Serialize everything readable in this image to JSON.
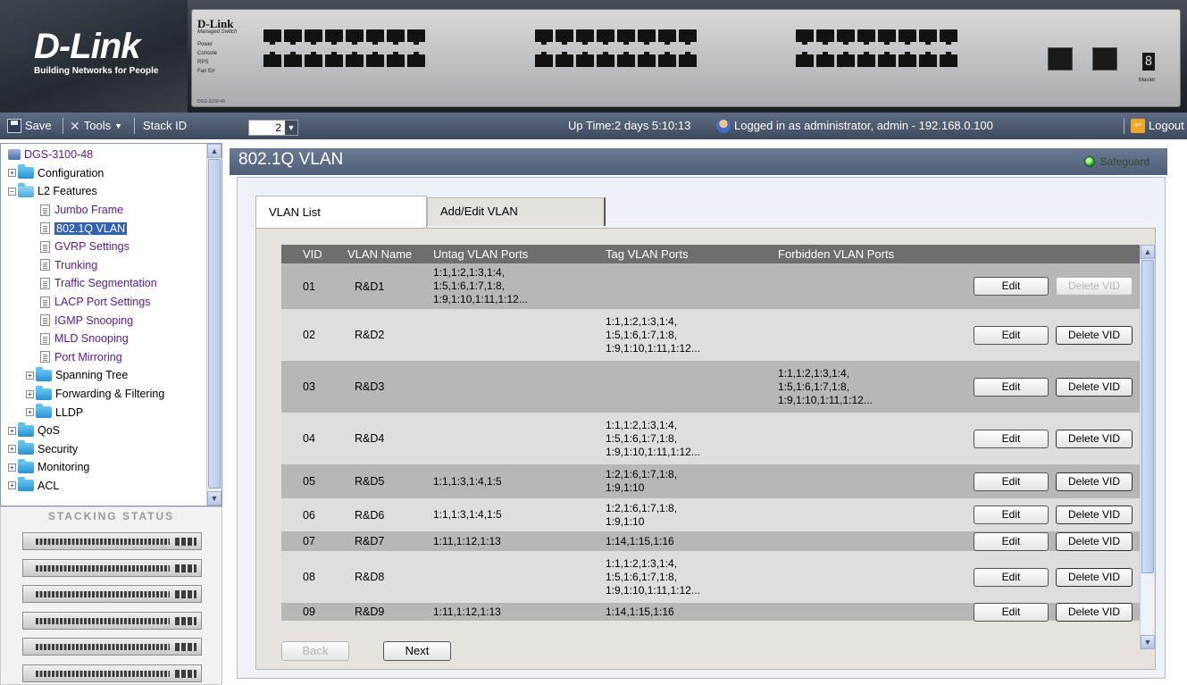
{
  "banner": {
    "logo": "D-Link",
    "tagline": "Building Networks for People",
    "device_brand": "D-Link",
    "device_sub": "Managed Switch",
    "leds": [
      "Power",
      "Console",
      "RPS",
      "Fan Err"
    ],
    "model": "DGS-3100-48",
    "combo_label": "Combo",
    "stack_digit": "8",
    "master_label": "Master"
  },
  "toolbar": {
    "save_label": "Save",
    "tools_label": "Tools",
    "stack_id_label": "Stack ID",
    "stack_id_value": "2",
    "uptime": "Up Time:2 days 5:10:13",
    "logged_in": "Logged in as administrator, admin - 192.168.0.100",
    "logout_label": "Logout"
  },
  "tree": {
    "root": "DGS-3100-48",
    "items": [
      {
        "label": "Configuration",
        "type": "folder",
        "level": 1,
        "expander": "+"
      },
      {
        "label": "L2 Features",
        "type": "folder-open",
        "level": 1,
        "expander": "−"
      },
      {
        "label": "Jumbo Frame",
        "type": "leaf",
        "level": 2
      },
      {
        "label": "802.1Q VLAN",
        "type": "leaf",
        "level": 2,
        "selected": true
      },
      {
        "label": "GVRP Settings",
        "type": "leaf",
        "level": 2
      },
      {
        "label": "Trunking",
        "type": "leaf",
        "level": 2
      },
      {
        "label": "Traffic Segmentation",
        "type": "leaf",
        "level": 2
      },
      {
        "label": "LACP Port Settings",
        "type": "leaf",
        "level": 2
      },
      {
        "label": "IGMP Snooping",
        "type": "leaf",
        "level": 2
      },
      {
        "label": "MLD Snooping",
        "type": "leaf",
        "level": 2
      },
      {
        "label": "Port Mirroring",
        "type": "leaf",
        "level": 2
      },
      {
        "label": "Spanning Tree",
        "type": "folder",
        "level": 2,
        "expander": "+"
      },
      {
        "label": "Forwarding & Filtering",
        "type": "folder",
        "level": 2,
        "expander": "+"
      },
      {
        "label": "LLDP",
        "type": "folder",
        "level": 2,
        "expander": "+"
      },
      {
        "label": "QoS",
        "type": "folder",
        "level": 1,
        "expander": "+"
      },
      {
        "label": "Security",
        "type": "folder",
        "level": 1,
        "expander": "+"
      },
      {
        "label": "Monitoring",
        "type": "folder",
        "level": 1,
        "expander": "+"
      },
      {
        "label": "ACL",
        "type": "folder",
        "level": 1,
        "expander": "+"
      }
    ]
  },
  "stacking": {
    "title": "STACKING STATUS",
    "unit_count": 6
  },
  "main": {
    "title": "802.1Q VLAN",
    "safeguard": "Safeguard",
    "tabs": [
      "VLAN List",
      "Add/Edit VLAN"
    ],
    "columns": [
      "VID",
      "VLAN Name",
      "Untag VLAN Ports",
      "Tag VLAN Ports",
      "Forbidden VLAN Ports"
    ],
    "rows": [
      {
        "vid": "01",
        "name": "R&D1",
        "untag": [
          "1:1,1:2,1:3,1:4,",
          "1:5,1:6,1:7,1:8,",
          "1:9,1:10,1:11,1:12..."
        ],
        "tag": [],
        "forbidden": [],
        "shade": "dark",
        "del_disabled": true
      },
      {
        "vid": "02",
        "name": "R&D2",
        "untag": [],
        "tag": [
          "1:1,1:2,1:3,1:4,",
          "1:5,1:6,1:7,1:8,",
          "1:9,1:10,1:11,1:12..."
        ],
        "forbidden": [],
        "shade": "light",
        "del_disabled": false
      },
      {
        "vid": "03",
        "name": "R&D3",
        "untag": [],
        "tag": [],
        "forbidden": [
          "1:1,1:2,1:3,1:4,",
          "1:5,1:6,1:7,1:8,",
          "1:9,1:10,1:11,1:12..."
        ],
        "shade": "dark",
        "del_disabled": false
      },
      {
        "vid": "04",
        "name": "R&D4",
        "untag": [],
        "tag": [
          "1:1,1:2,1:3,1:4,",
          "1:5,1:6,1:7,1:8,",
          "1:9,1:10,1:11,1:12..."
        ],
        "forbidden": [],
        "shade": "light",
        "del_disabled": false
      },
      {
        "vid": "05",
        "name": "R&D5",
        "untag": [
          "1:1,1:3,1:4,1:5"
        ],
        "tag": [
          "1:2,1:6,1:7,1:8,",
          "1:9,1:10"
        ],
        "forbidden": [],
        "shade": "dark",
        "del_disabled": false
      },
      {
        "vid": "06",
        "name": "R&D6",
        "untag": [
          "1:1,1:3,1:4,1:5"
        ],
        "tag": [
          "1:2,1:6,1:7,1:8,",
          "1:9,1:10"
        ],
        "forbidden": [],
        "shade": "light",
        "del_disabled": false
      },
      {
        "vid": "07",
        "name": "R&D7",
        "untag": [
          "1:11,1:12,1:13"
        ],
        "tag": [
          "1:14,1:15,1:16"
        ],
        "forbidden": [],
        "shade": "dark",
        "del_disabled": false
      },
      {
        "vid": "08",
        "name": "R&D8",
        "untag": [],
        "tag": [
          "1:1,1:2,1:3,1:4,",
          "1:5,1:6,1:7,1:8,",
          "1:9,1:10,1:11,1:12..."
        ],
        "forbidden": [],
        "shade": "light",
        "del_disabled": false
      },
      {
        "vid": "09",
        "name": "R&D9",
        "untag": [
          "1:11,1:12,1:13"
        ],
        "tag": [
          "1:14,1:15,1:16"
        ],
        "forbidden": [],
        "shade": "dark",
        "del_disabled": false
      }
    ],
    "edit_label": "Edit",
    "delete_label": "Delete VID",
    "back_label": "Back",
    "next_label": "Next"
  }
}
